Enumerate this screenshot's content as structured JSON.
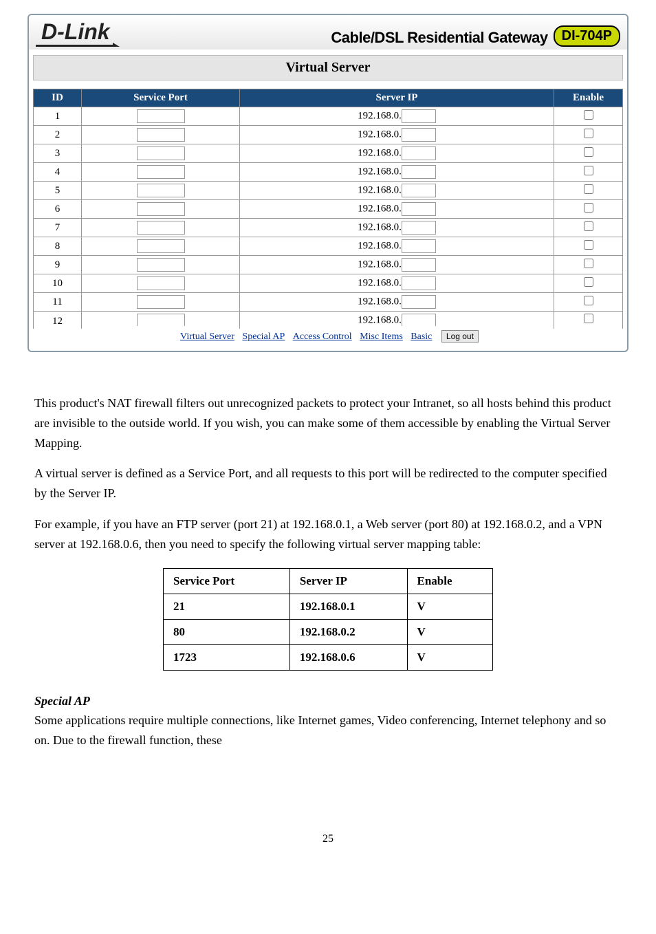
{
  "header": {
    "logo": "D-Link",
    "subtitle": "Cable/DSL Residential Gateway",
    "model": "DI-704P",
    "section_title": "Virtual Server"
  },
  "table": {
    "headers": {
      "id": "ID",
      "port": "Service Port",
      "ip": "Server IP",
      "enable": "Enable"
    },
    "ip_prefix": "192.168.0.",
    "rows": [
      {
        "id": "1"
      },
      {
        "id": "2"
      },
      {
        "id": "3"
      },
      {
        "id": "4"
      },
      {
        "id": "5"
      },
      {
        "id": "6"
      },
      {
        "id": "7"
      },
      {
        "id": "8"
      },
      {
        "id": "9"
      },
      {
        "id": "10"
      },
      {
        "id": "11"
      },
      {
        "id": "12"
      }
    ]
  },
  "nav": {
    "virtual_server": "Virtual Server",
    "special_ap": "Special AP",
    "access_control": "Access Control",
    "misc_items": "Misc Items",
    "basic": "Basic",
    "logout": "Log out"
  },
  "doc": {
    "p1": "This product's NAT firewall filters out unrecognized packets to protect your Intranet, so all hosts behind this product are invisible to the outside world. If you wish, you can make some of them accessible by enabling the Virtual Server Mapping.",
    "p2": "A virtual server is defined as a Service Port, and all requests to this port will be redirected to the computer specified by the Server IP.",
    "p3": "For example, if you have an FTP server (port 21) at 192.168.0.1, a Web server (port 80) at 192.168.0.2, and a VPN server at 192.168.0.6, then you need to specify the following virtual server mapping table:",
    "example": {
      "headers": {
        "sp": "Service Port",
        "si": "Server IP",
        "en": "Enable"
      },
      "rows": [
        {
          "sp": "21",
          "si": "192.168.0.1",
          "en": "V"
        },
        {
          "sp": "80",
          "si": "192.168.0.2",
          "en": "V"
        },
        {
          "sp": "1723",
          "si": "192.168.0.6",
          "en": "V"
        }
      ]
    },
    "special_ap_head": "Special AP",
    "p4": "Some applications require multiple connections, like Internet games, Video conferencing, Internet telephony and so on. Due to the firewall function, these",
    "page_num": "25"
  }
}
